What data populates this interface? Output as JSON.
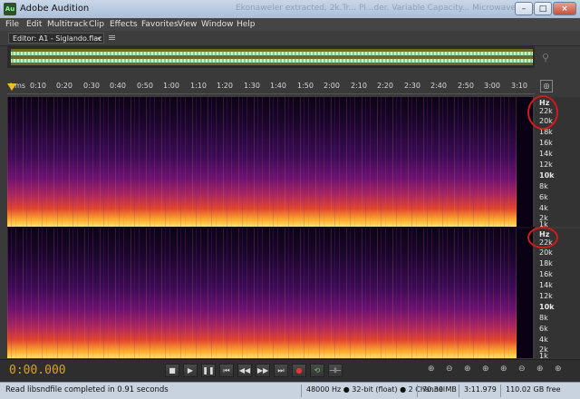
{
  "window": {
    "title": "Adobe Audition",
    "app_icon": "Au",
    "ghost_text": "Ekonaweler extracted, 2k.Tr... Pl...der. Variable Capacity... Microwave Jouana",
    "minimize_label": "–",
    "maximize_label": "□",
    "close_label": "×"
  },
  "menu": [
    "File",
    "Edit",
    "Multitrack",
    "Clip",
    "Effects",
    "Favorites",
    "View",
    "Window",
    "Help"
  ],
  "editor": {
    "dropdown_value": "Editor: A1 - Siglando.flac",
    "dropdown_chevron": "▾",
    "panel_menu_icon": "≡"
  },
  "timeline": {
    "unit": "hms",
    "ticks": [
      "0:10",
      "0:20",
      "0:30",
      "0:40",
      "0:50",
      "1:00",
      "1:10",
      "1:20",
      "1:30",
      "1:40",
      "1:50",
      "2:00",
      "2:10",
      "2:20",
      "2:30",
      "2:40",
      "2:50",
      "3:00",
      "3:10"
    ]
  },
  "frequency_axis": {
    "channel1": [
      "Hz",
      "22k",
      "20k",
      "18k",
      "16k",
      "14k",
      "12k",
      "10k",
      "8k",
      "6k",
      "4k",
      "2k",
      "1k"
    ],
    "channel2": [
      "Hz",
      "22k",
      "20k",
      "18k",
      "16k",
      "14k",
      "12k",
      "10k",
      "8k",
      "6k",
      "4k",
      "2k",
      "1k"
    ]
  },
  "transport": {
    "timecode": "0:00.000",
    "buttons": [
      {
        "name": "stop-button",
        "icon": "■"
      },
      {
        "name": "play-button",
        "icon": "▶"
      },
      {
        "name": "pause-button",
        "icon": "❚❚"
      },
      {
        "name": "move-to-previous-button",
        "icon": "⏮"
      },
      {
        "name": "rewind-button",
        "icon": "◀◀"
      },
      {
        "name": "fast-forward-button",
        "icon": "▶▶"
      },
      {
        "name": "move-to-next-button",
        "icon": "⏭"
      },
      {
        "name": "record-button",
        "icon": "●"
      },
      {
        "name": "loop-playback-button",
        "icon": "⟲"
      },
      {
        "name": "skip-selection-button",
        "icon": "⊣⊢"
      }
    ],
    "zoom_buttons": [
      "⊕",
      "⊖",
      "⊕",
      "⊕",
      "⊕",
      "⊖",
      "⊕",
      "⊕"
    ]
  },
  "status": {
    "message": "Read libsndfile completed in 0.91 seconds",
    "sample_format": "48000 Hz ● 32-bit (float) ● 2 Channel",
    "file_size": "70.30 MB",
    "duration": "3:11.979",
    "free_space": "110.02 GB free"
  },
  "colors": {
    "timecode": "#e0a020",
    "annotation_circle": "#d41a1a",
    "overview_wave": "#b6f0c4"
  }
}
